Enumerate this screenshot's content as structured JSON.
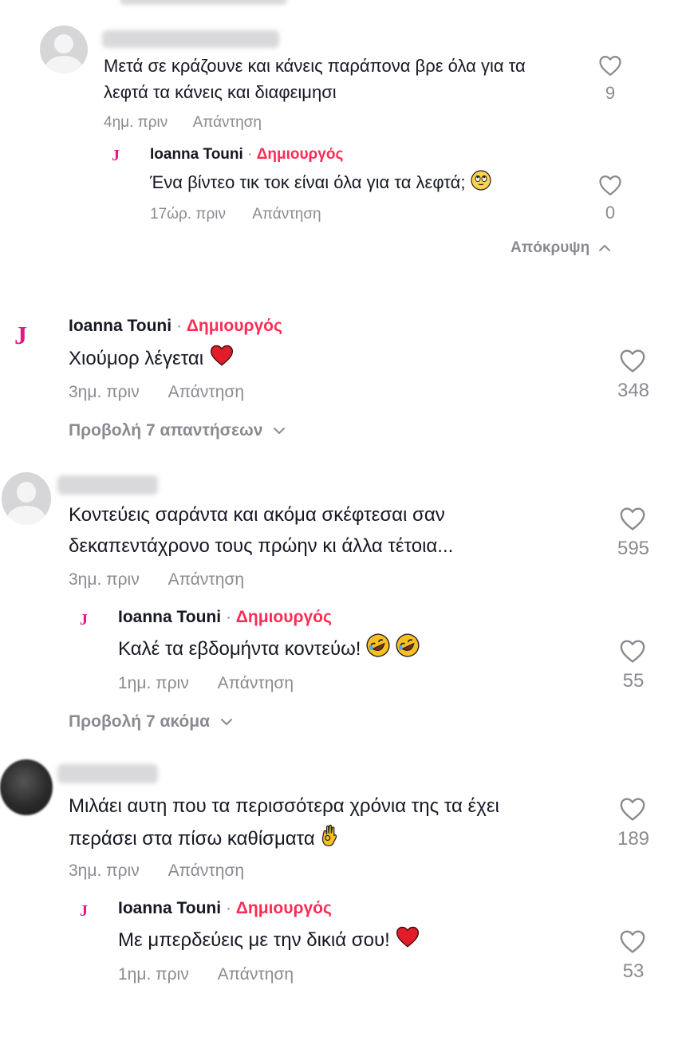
{
  "comments": [
    {
      "text": "Μετά σε κράζουνε και κάνεις παράπονα βρε όλα για τα λεφτά τα κάνεις και διαφειμησι",
      "time": "4ημ. πριν",
      "reply_label": "Απάντηση",
      "likes": "9"
    },
    {
      "author": "Ioanna Touni",
      "badge": "Δημιουργός",
      "separator": "·",
      "logo": "J",
      "text": "Ένα βίντεο τικ τοκ είναι όλα για τα λεφτά;",
      "emoji": "rolling-eyes-face",
      "time": "17ώρ. πριν",
      "reply_label": "Απάντηση",
      "likes": "0"
    },
    {
      "hide_label": "Απόκρυψη",
      "hide_icon": "chevron-up-icon"
    },
    {
      "author": "Ioanna Touni",
      "badge": "Δημιουργός",
      "separator": "·",
      "logo": "J",
      "text": "Χιούμορ λέγεται",
      "emoji": "red-heart",
      "time": "3ημ. πριν",
      "reply_label": "Απάντηση",
      "likes": "348",
      "view_replies": "Προβολή 7 απαντήσεων"
    },
    {
      "text_line1": "Κοντεύεις σαράντα και ακόμα σκέφτεσαι σαν",
      "text_line2": "δεκαπεντάχρονο τους πρώην κι άλλα τέτοια...",
      "time": "3ημ. πριν",
      "reply_label": "Απάντηση",
      "likes": "595"
    },
    {
      "author": "Ioanna Touni",
      "badge": "Δημιουργός",
      "separator": "·",
      "logo": "J",
      "text": "Καλέ τα εβδομήντα κοντεύω!",
      "emoji": "rolling-on-floor-laughing x2",
      "time": "1ημ. πριν",
      "reply_label": "Απάντηση",
      "likes": "55",
      "view_more": "Προβολή 7 ακόμα"
    },
    {
      "text_line1": "Μιλάει αυτη που τα περισσότερα χρόνια της τα έχει",
      "text_line2": "περάσει στα πίσω καθίσματα",
      "emoji": "ok-hand",
      "time": "3ημ. πριν",
      "reply_label": "Απάντηση",
      "likes": "189"
    },
    {
      "author": "Ioanna Touni",
      "badge": "Δημιουργός",
      "separator": "·",
      "logo": "J",
      "text": "Με μπερδεύεις με την δικιά σου!",
      "emoji": "red-heart",
      "time": "1ημ. πριν",
      "reply_label": "Απάντηση",
      "likes": "53"
    }
  ],
  "colors": {
    "creator_badge": "#fe2c55",
    "logo": "#e4168a",
    "meta_text": "#8a8b91",
    "text": "#161823"
  }
}
